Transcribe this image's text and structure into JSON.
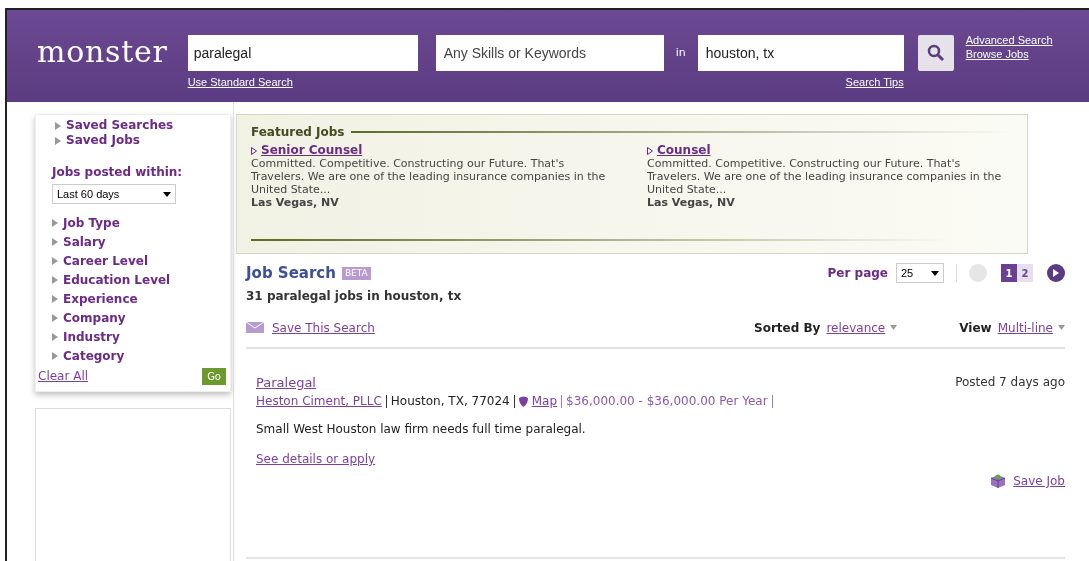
{
  "header": {
    "logo": "monster",
    "keywords": "paralegal",
    "skills_placeholder": "Any Skills or Keywords",
    "in_label": "in",
    "location": "houston, tx",
    "standard_search": "Use Standard Search",
    "search_tips": "Search Tips",
    "links": [
      "Advanced Search",
      "Browse Jobs"
    ]
  },
  "sidebar": {
    "saved": [
      "Saved Searches",
      "Saved Jobs"
    ],
    "posted_label": "Jobs posted within:",
    "posted_value": "Last 60 days",
    "filters": [
      "Job Type",
      "Salary",
      "Career Level",
      "Education Level",
      "Experience",
      "Company",
      "Industry",
      "Category"
    ],
    "clear": "Clear All",
    "go": "Go"
  },
  "featured": {
    "title": "Featured Jobs",
    "jobs": [
      {
        "title": "Senior Counsel",
        "desc": "Committed. Competitive. Constructing our Future. That's Travelers. We are one of the leading insurance companies in the United State...",
        "location": "Las Vegas, NV"
      },
      {
        "title": "Counsel",
        "desc": "Committed. Competitive. Constructing our Future. That's Travelers. We are one of the leading insurance companies in the United State...",
        "location": "Las Vegas, NV"
      }
    ]
  },
  "results": {
    "title": "Job Search",
    "badge": "BETA",
    "summary": "31 paralegal jobs in houston, tx",
    "per_page_label": "Per page",
    "per_page": "25",
    "pages": [
      {
        "label": "1",
        "selected": true
      },
      {
        "label": "2",
        "selected": false
      }
    ],
    "prev_disabled": true,
    "next_disabled": false,
    "save_search": "Save This Search",
    "sorted_label": "Sorted By",
    "sorted_value": "relevance",
    "view_label": "View",
    "view_value": "Multi-line",
    "jobs": [
      {
        "title": "Paralegal",
        "company": "Heston Ciment, PLLC",
        "location": "Houston, TX, 77024",
        "map": "Map",
        "salary": "$36,000.00 - $36,000.00 Per Year",
        "posted": "Posted 7 days ago",
        "desc": "Small West Houston law firm needs full time paralegal.",
        "details": "See details or apply",
        "save": "Save Job"
      }
    ]
  }
}
